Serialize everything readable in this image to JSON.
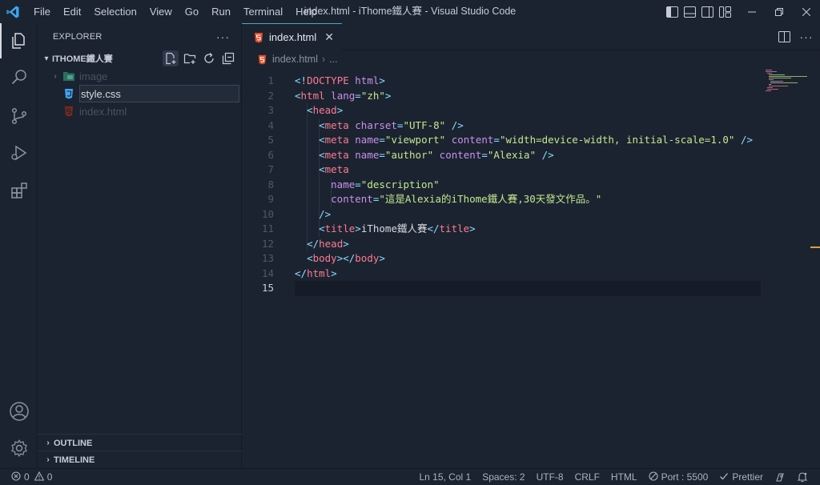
{
  "menu": [
    "File",
    "Edit",
    "Selection",
    "View",
    "Go",
    "Run",
    "Terminal",
    "Help"
  ],
  "window_title": "index.html - iThome鐵人賽 - Visual Studio Code",
  "explorer": {
    "header": "EXPLORER",
    "more": "···",
    "folder": "ITHOME鐵人賽",
    "items": [
      {
        "name": "image",
        "type": "folder"
      },
      {
        "name": "style.css",
        "type": "css"
      },
      {
        "name": "index.html",
        "type": "html"
      }
    ],
    "rename_value": "style.css",
    "outline": "OUTLINE",
    "timeline": "TIMELINE"
  },
  "tab": {
    "label": "index.html",
    "close": "✕"
  },
  "breadcrumb": {
    "file": "index.html",
    "more": "..."
  },
  "code": {
    "current_line": 15,
    "lines": [
      [
        [
          "<!",
          "punc"
        ],
        [
          "DOCTYPE",
          "tag"
        ],
        [
          " ",
          "text"
        ],
        [
          "html",
          "attr"
        ],
        [
          ">",
          "punc"
        ]
      ],
      [
        [
          "<",
          "punc"
        ],
        [
          "html",
          "tag"
        ],
        [
          " ",
          "text"
        ],
        [
          "lang",
          "attr"
        ],
        [
          "=",
          "punc"
        ],
        [
          "\"zh\"",
          "str"
        ],
        [
          ">",
          "punc"
        ]
      ],
      [
        [
          "  ",
          "text"
        ],
        [
          "<",
          "punc"
        ],
        [
          "head",
          "tag"
        ],
        [
          ">",
          "punc"
        ]
      ],
      [
        [
          "    ",
          "text"
        ],
        [
          "<",
          "punc"
        ],
        [
          "meta",
          "tag"
        ],
        [
          " ",
          "text"
        ],
        [
          "charset",
          "attr"
        ],
        [
          "=",
          "punc"
        ],
        [
          "\"UTF-8\"",
          "str"
        ],
        [
          " />",
          "punc"
        ]
      ],
      [
        [
          "    ",
          "text"
        ],
        [
          "<",
          "punc"
        ],
        [
          "meta",
          "tag"
        ],
        [
          " ",
          "text"
        ],
        [
          "name",
          "attr"
        ],
        [
          "=",
          "punc"
        ],
        [
          "\"viewport\"",
          "str"
        ],
        [
          " ",
          "text"
        ],
        [
          "content",
          "attr"
        ],
        [
          "=",
          "punc"
        ],
        [
          "\"width=device-width, initial-scale=1.0\"",
          "str"
        ],
        [
          " />",
          "punc"
        ]
      ],
      [
        [
          "    ",
          "text"
        ],
        [
          "<",
          "punc"
        ],
        [
          "meta",
          "tag"
        ],
        [
          " ",
          "text"
        ],
        [
          "name",
          "attr"
        ],
        [
          "=",
          "punc"
        ],
        [
          "\"author\"",
          "str"
        ],
        [
          " ",
          "text"
        ],
        [
          "content",
          "attr"
        ],
        [
          "=",
          "punc"
        ],
        [
          "\"Alexia\"",
          "str"
        ],
        [
          " />",
          "punc"
        ]
      ],
      [
        [
          "    ",
          "text"
        ],
        [
          "<",
          "punc"
        ],
        [
          "meta",
          "tag"
        ]
      ],
      [
        [
          "      ",
          "text"
        ],
        [
          "name",
          "attr"
        ],
        [
          "=",
          "punc"
        ],
        [
          "\"description\"",
          "str"
        ]
      ],
      [
        [
          "      ",
          "text"
        ],
        [
          "content",
          "attr"
        ],
        [
          "=",
          "punc"
        ],
        [
          "\"這是Alexia的iThome鐵人賽,30天發文作品。\"",
          "str"
        ]
      ],
      [
        [
          "    ",
          "text"
        ],
        [
          "/>",
          "punc"
        ]
      ],
      [
        [
          "    ",
          "text"
        ],
        [
          "<",
          "punc"
        ],
        [
          "title",
          "tag"
        ],
        [
          ">",
          "punc"
        ],
        [
          "iThome鐵人賽",
          "text"
        ],
        [
          "</",
          "punc"
        ],
        [
          "title",
          "tag"
        ],
        [
          ">",
          "punc"
        ]
      ],
      [
        [
          "  ",
          "text"
        ],
        [
          "</",
          "punc"
        ],
        [
          "head",
          "tag"
        ],
        [
          ">",
          "punc"
        ]
      ],
      [
        [
          "  ",
          "text"
        ],
        [
          "<",
          "punc"
        ],
        [
          "body",
          "tag"
        ],
        [
          "></",
          "punc"
        ],
        [
          "body",
          "tag"
        ],
        [
          ">",
          "punc"
        ]
      ],
      [
        [
          "</",
          "punc"
        ],
        [
          "html",
          "tag"
        ],
        [
          ">",
          "punc"
        ]
      ],
      []
    ]
  },
  "status": {
    "errors": "0",
    "warnings": "0",
    "position": "Ln 15, Col 1",
    "spaces": "Spaces: 2",
    "encoding": "UTF-8",
    "eol": "CRLF",
    "language": "HTML",
    "port": "Port : 5500",
    "prettier": "Prettier"
  },
  "colors": {
    "background": "#1b2330",
    "tab_accent": "#4da6c7",
    "tag": "#ff7a90",
    "attribute": "#c792ea",
    "string": "#c3e88d",
    "punctuation": "#89ddff",
    "html_icon": "#e44d26",
    "css_icon": "#42a5f5"
  }
}
